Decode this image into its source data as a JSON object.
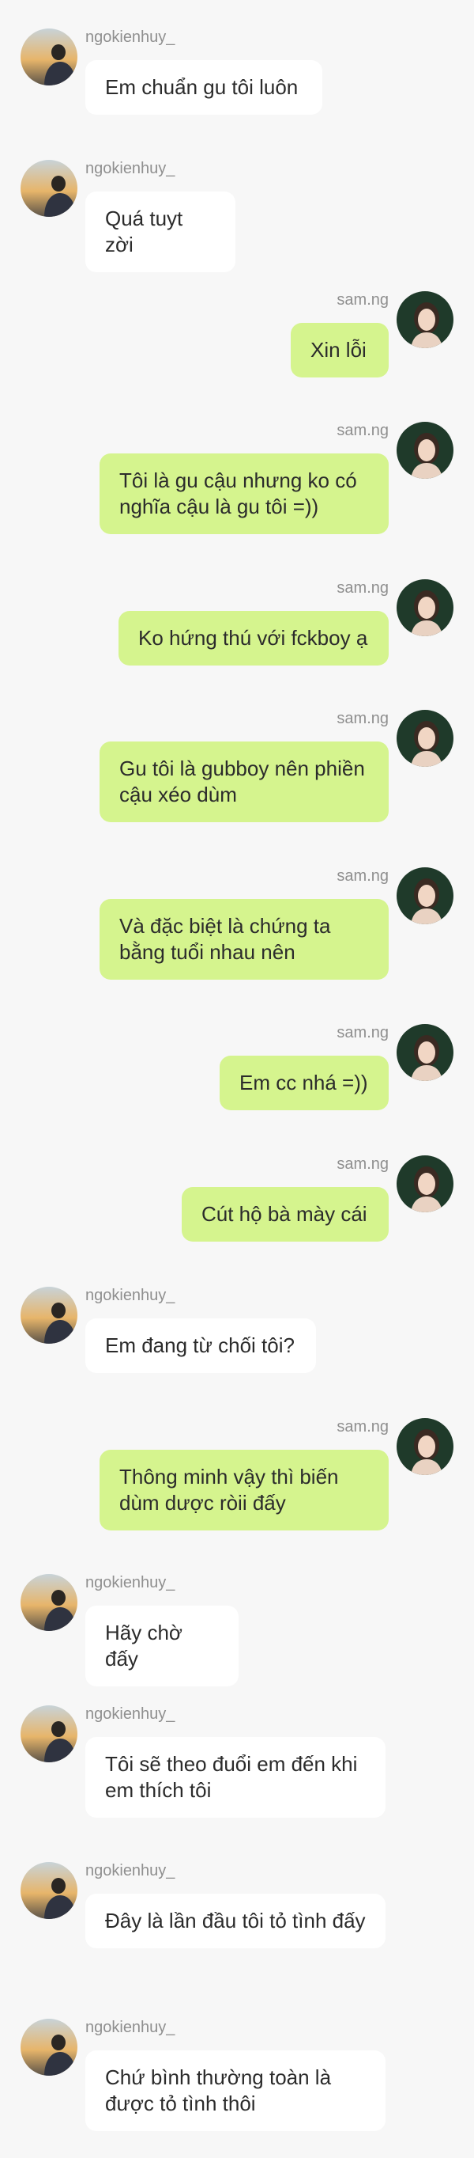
{
  "users": {
    "left": {
      "username": "ngokienhuy_"
    },
    "right": {
      "username": "sam.ng"
    }
  },
  "colors": {
    "background": "#f7f7f7",
    "incoming_bubble": "#ffffff",
    "outgoing_bubble": "#d5f48e",
    "username_text": "#8f8f8f",
    "message_text": "#2b2b2b"
  },
  "messages": [
    {
      "side": "left",
      "username": "ngokienhuy_",
      "text": "Em chuẩn gu tôi luôn"
    },
    {
      "side": "left",
      "username": "ngokienhuy_",
      "text": "Quá tuyt zời"
    },
    {
      "side": "right",
      "username": "sam.ng",
      "text": "Xin lỗi"
    },
    {
      "side": "right",
      "username": "sam.ng",
      "text": "Tôi là gu cậu nhưng ko có nghĩa cậu là gu tôi =))"
    },
    {
      "side": "right",
      "username": "sam.ng",
      "text": "Ko hứng thú với fckboy ạ"
    },
    {
      "side": "right",
      "username": "sam.ng",
      "text": "Gu tôi là gubboy nên phiền cậu xéo dùm"
    },
    {
      "side": "right",
      "username": "sam.ng",
      "text": "Và đặc biệt là chứng ta bằng tuổi nhau nên"
    },
    {
      "side": "right",
      "username": "sam.ng",
      "text": "Em cc nhá =))"
    },
    {
      "side": "right",
      "username": "sam.ng",
      "text": "Cút hộ bà mày cái"
    },
    {
      "side": "left",
      "username": "ngokienhuy_",
      "text": "Em đang từ chối tôi?"
    },
    {
      "side": "right",
      "username": "sam.ng",
      "text": "Thông minh vậy thì biến dùm dược ròii đấy"
    },
    {
      "side": "left",
      "username": "ngokienhuy_",
      "text": "Hãy chờ đấy"
    },
    {
      "side": "left",
      "username": "ngokienhuy_",
      "text": "Tôi sẽ theo đuổi em đến khi em thích tôi"
    },
    {
      "side": "left",
      "username": "ngokienhuy_",
      "text": "Đây là lần đầu tôi tỏ tình đấy"
    },
    {
      "side": "left",
      "username": "ngokienhuy_",
      "text": "Chứ bình thường toàn là được tỏ tình thôi"
    }
  ]
}
